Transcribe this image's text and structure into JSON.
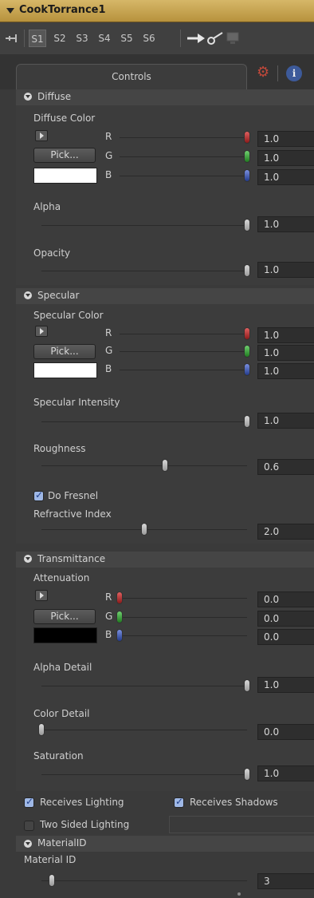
{
  "tool": {
    "name": "CookTorrance1"
  },
  "view_tabs": [
    "S1",
    "S2",
    "S3",
    "S4",
    "S5",
    "S6"
  ],
  "tabs": {
    "controls": "Controls"
  },
  "diffuse": {
    "header": "Diffuse",
    "color_label": "Diffuse Color",
    "pick_label": "Pick...",
    "r_label": "R",
    "g_label": "G",
    "b_label": "B",
    "r": "1.0",
    "g": "1.0",
    "b": "1.0",
    "r_level": 1.0,
    "g_level": 1.0,
    "b_level": 1.0,
    "swatch_color": "#ffffff",
    "alpha_label": "Alpha",
    "alpha": "1.0",
    "alpha_level": 1.0,
    "opacity_label": "Opacity",
    "opacity": "1.0",
    "opacity_level": 1.0
  },
  "specular": {
    "header": "Specular",
    "color_label": "Specular Color",
    "pick_label": "Pick...",
    "r_label": "R",
    "g_label": "G",
    "b_label": "B",
    "r": "1.0",
    "g": "1.0",
    "b": "1.0",
    "r_level": 1.0,
    "g_level": 1.0,
    "b_level": 1.0,
    "swatch_color": "#ffffff",
    "intensity_label": "Specular Intensity",
    "intensity": "1.0",
    "intensity_level": 1.0,
    "roughness_label": "Roughness",
    "roughness": "0.6",
    "roughness_level": 0.6,
    "fresnel_label": "Do Fresnel",
    "fresnel_checked": true,
    "refractive_label": "Refractive Index",
    "refractive": "2.0",
    "refractive_level": 0.5
  },
  "transmittance": {
    "header": "Transmittance",
    "attenuation_label": "Attenuation",
    "pick_label": "Pick...",
    "r_label": "R",
    "g_label": "G",
    "b_label": "B",
    "r": "0.0",
    "g": "0.0",
    "b": "0.0",
    "r_level": 0.0,
    "g_level": 0.0,
    "b_level": 0.0,
    "swatch_color": "#000000",
    "alpha_detail_label": "Alpha Detail",
    "alpha_detail": "1.0",
    "alpha_detail_level": 1.0,
    "color_detail_label": "Color Detail",
    "color_detail": "0.0",
    "color_detail_level": 0.0,
    "saturation_label": "Saturation",
    "saturation": "1.0",
    "saturation_level": 1.0
  },
  "lighting": {
    "receives_lighting": "Receives Lighting",
    "receives_lighting_checked": true,
    "receives_shadows": "Receives Shadows",
    "receives_shadows_checked": true,
    "two_sided": "Two Sided Lighting",
    "two_sided_checked": false
  },
  "material": {
    "header": "MaterialID",
    "label": "Material ID",
    "value": "3",
    "level": 0.05
  },
  "colors": {
    "title_bar": "#c9a651",
    "gear": "#c0483a",
    "info": "#3d5a9a",
    "r": "#c03030",
    "g": "#30a030",
    "b": "#3050c0"
  }
}
